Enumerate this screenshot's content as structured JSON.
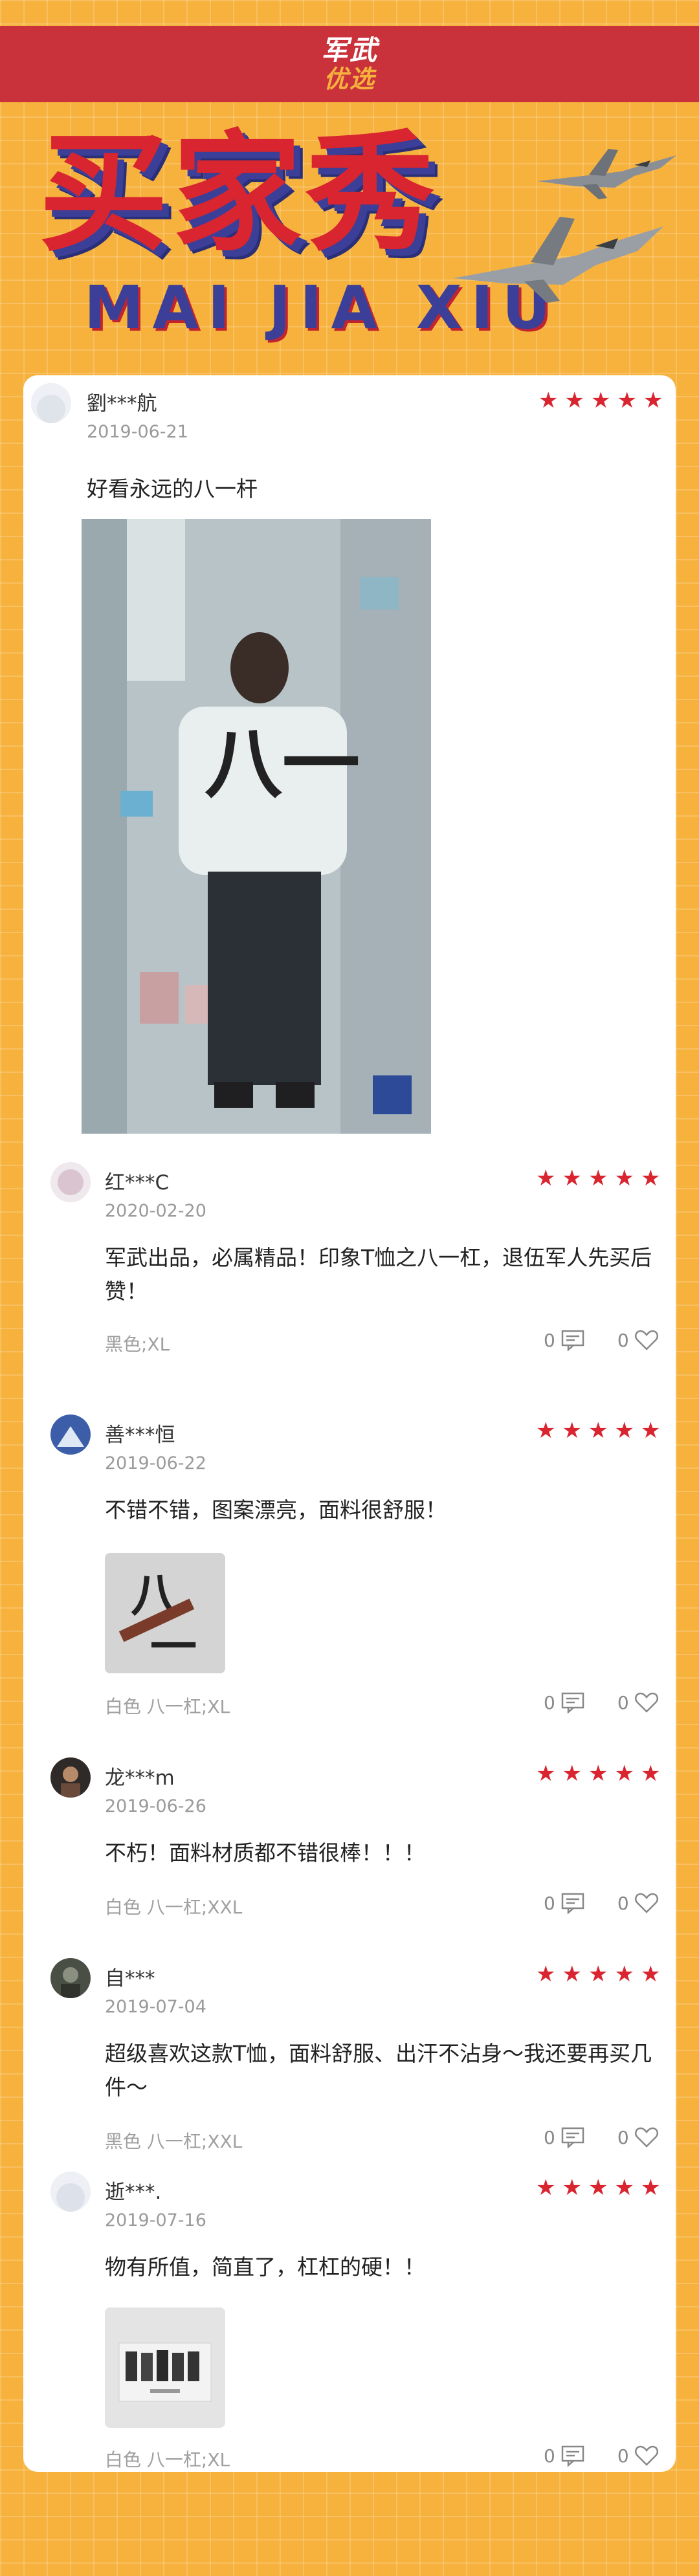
{
  "header": {
    "logo_line1": "军武",
    "logo_line2": "优选"
  },
  "hero": {
    "title": "买家秀",
    "subtitle": "MAI JIA XIU"
  },
  "colors": {
    "background": "#f7b23e",
    "topbar": "#c9323b",
    "title_red": "#d8252f",
    "title_blue": "#3b3f98",
    "star_red": "#d8252f"
  },
  "reviews": [
    {
      "name": "劉***航",
      "date": "2019-06-21",
      "rating": 5,
      "text": "好看永远的八一杆",
      "spec": "",
      "comments": "",
      "likes": "",
      "photo": "large-tshirt-photo"
    },
    {
      "name": "红***C",
      "date": "2020-02-20",
      "rating": 5,
      "text": "军武出品，必属精品！印象T恤之八一杠，退伍军人先买后赞！",
      "spec": "黑色;XL",
      "comments": "0",
      "likes": "0"
    },
    {
      "name": "善***恒",
      "date": "2019-06-22",
      "rating": 5,
      "text": "不错不错，图案漂亮，面料很舒服！",
      "spec": "白色 八一杠;XL",
      "comments": "0",
      "likes": "0",
      "photo": "tshirt-print-thumb"
    },
    {
      "name": "龙***m",
      "date": "2019-06-26",
      "rating": 5,
      "text": "不朽！面料材质都不错很棒！！！",
      "spec": "白色 八一杠;XXL",
      "comments": "0",
      "likes": "0"
    },
    {
      "name": "自***",
      "date": "2019-07-04",
      "rating": 5,
      "text": "超级喜欢这款T恤，面料舒服、出汗不沾身～我还要再买几件～",
      "spec": "黑色 八一杠;XXL",
      "comments": "0",
      "likes": "0"
    },
    {
      "name": "逝***.",
      "date": "2019-07-16",
      "rating": 5,
      "text": "物有所值，简直了，杠杠的硬！！",
      "spec": "白色 八一杠;XL",
      "comments": "0",
      "likes": "0",
      "photo": "group-photo-thumb"
    }
  ],
  "icons": {
    "comment": "comment-icon",
    "like": "heart-icon",
    "star": "star-icon"
  }
}
